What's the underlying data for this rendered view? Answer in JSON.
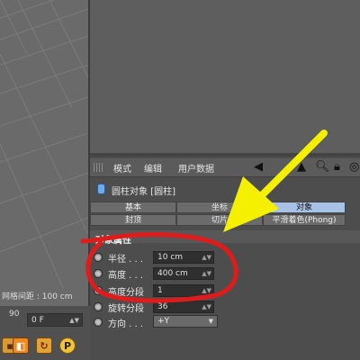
{
  "viewport": {
    "grid_spacing_label": "网格间距 : 100 cm"
  },
  "timeline": {
    "frame_marker": "90",
    "frame_field": "0 F"
  },
  "attribute_manager": {
    "menu": [
      "模式",
      "编辑",
      "用户数据"
    ],
    "object_title": "圆柱对象 [圆柱]",
    "tabs_row1": [
      "基本",
      "坐标",
      "对象"
    ],
    "tabs_row2": [
      "封顶",
      "切片",
      "平滑着色(Phong)"
    ],
    "active_tab": "对象",
    "section_title": "对象属性",
    "properties": [
      {
        "label": "半径 . . .",
        "value": "10 cm"
      },
      {
        "label": "高度 . . .",
        "value": "400 cm"
      },
      {
        "label": "高度分段",
        "value": "1"
      },
      {
        "label": "旋转分段",
        "value": "36"
      },
      {
        "label": "方向 . . .",
        "value": "+Y"
      }
    ]
  },
  "colors": {
    "annotation_red": "#e01b1b",
    "annotation_arrow": "#f4f000",
    "active_tab": "#a7c2e6"
  },
  "icons": [
    "arrow-cursor-icon",
    "arrow-left-icon",
    "search-icon",
    "lock-icon",
    "target-icon",
    "cylinder-object-icon",
    "keyframe-icon",
    "record-icon",
    "autokey-icon"
  ]
}
